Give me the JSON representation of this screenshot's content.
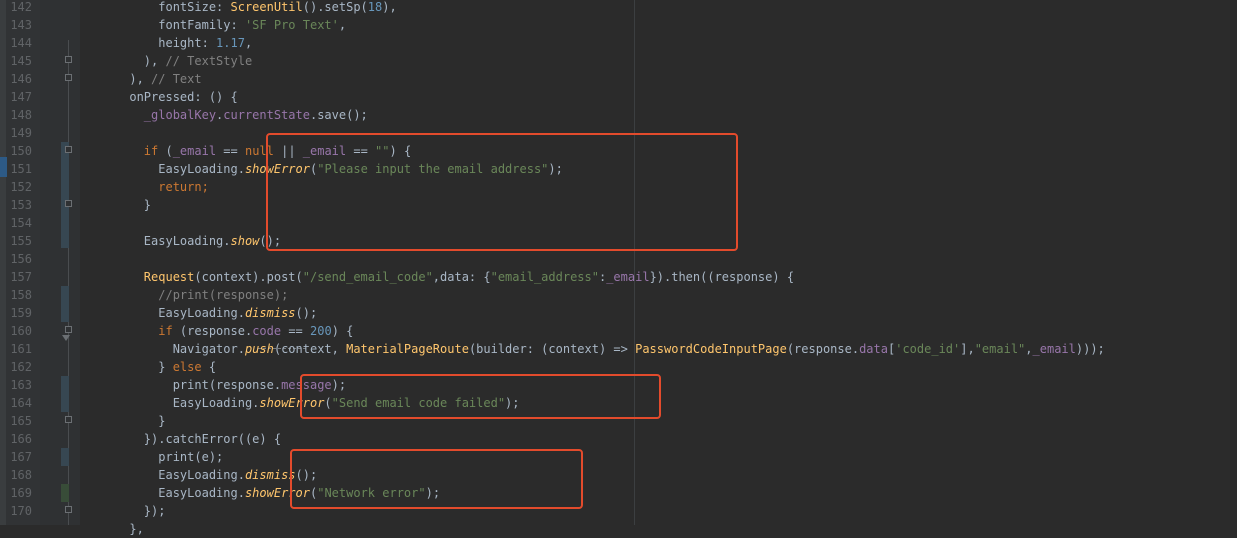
{
  "editor": {
    "lines": [
      {
        "n": "142",
        "tokens": [
          {
            "t": "          fontSize: "
          },
          {
            "t": "ScreenUtil",
            "c": "cls"
          },
          {
            "t": "().setSp("
          },
          {
            "t": "18",
            "c": "num"
          },
          {
            "t": "),"
          }
        ]
      },
      {
        "n": "143",
        "tokens": [
          {
            "t": "          fontFamily: "
          },
          {
            "t": "'SF Pro Text'",
            "c": "str"
          },
          {
            "t": ","
          }
        ]
      },
      {
        "n": "144",
        "tokens": [
          {
            "t": "          height: "
          },
          {
            "t": "1.17",
            "c": "num"
          },
          {
            "t": ","
          }
        ]
      },
      {
        "n": "145",
        "tokens": [
          {
            "t": "        ), "
          },
          {
            "t": "// TextStyle",
            "c": "com"
          }
        ]
      },
      {
        "n": "146",
        "tokens": [
          {
            "t": "      ), "
          },
          {
            "t": "// Text",
            "c": "com"
          }
        ]
      },
      {
        "n": "147",
        "tokens": [
          {
            "t": "      onPressed: () {"
          }
        ]
      },
      {
        "n": "148",
        "tokens": [
          {
            "t": "        "
          },
          {
            "t": "_globalKey",
            "c": "fld"
          },
          {
            "t": "."
          },
          {
            "t": "currentState",
            "c": "fld"
          },
          {
            "t": ".save();"
          }
        ]
      },
      {
        "n": "149",
        "tokens": [
          {
            "t": ""
          }
        ]
      },
      {
        "n": "150",
        "tokens": [
          {
            "t": "        "
          },
          {
            "t": "if",
            "c": "kw"
          },
          {
            "t": " ("
          },
          {
            "t": "_email",
            "c": "fld"
          },
          {
            "t": " == "
          },
          {
            "t": "null",
            "c": "kw"
          },
          {
            "t": " || "
          },
          {
            "t": "_email",
            "c": "fld"
          },
          {
            "t": " == "
          },
          {
            "t": "\"\"",
            "c": "str"
          },
          {
            "t": ") {"
          }
        ]
      },
      {
        "n": "151",
        "tokens": [
          {
            "t": "          EasyLoading."
          },
          {
            "t": "showError",
            "c": "ital"
          },
          {
            "t": "("
          },
          {
            "t": "\"Please input the email address\"",
            "c": "str"
          },
          {
            "t": ");"
          }
        ]
      },
      {
        "n": "152",
        "tokens": [
          {
            "t": "          "
          },
          {
            "t": "return;",
            "c": "kw"
          }
        ]
      },
      {
        "n": "153",
        "tokens": [
          {
            "t": "        }"
          }
        ]
      },
      {
        "n": "154",
        "tokens": [
          {
            "t": ""
          }
        ]
      },
      {
        "n": "155",
        "tokens": [
          {
            "t": "        EasyLoading."
          },
          {
            "t": "show",
            "c": "ital"
          },
          {
            "t": "();"
          }
        ]
      },
      {
        "n": "156",
        "tokens": [
          {
            "t": ""
          }
        ]
      },
      {
        "n": "157",
        "tokens": [
          {
            "t": "        "
          },
          {
            "t": "Request",
            "c": "cls"
          },
          {
            "t": "(context).post("
          },
          {
            "t": "\"/send_email_code\"",
            "c": "str"
          },
          {
            "t": ",data: {"
          },
          {
            "t": "\"email_address\"",
            "c": "str"
          },
          {
            "t": ":"
          },
          {
            "t": "_email",
            "c": "fld"
          },
          {
            "t": "}).then((response) {"
          }
        ]
      },
      {
        "n": "158",
        "tokens": [
          {
            "t": "          "
          },
          {
            "t": "//print(response);",
            "c": "com"
          }
        ]
      },
      {
        "n": "159",
        "tokens": [
          {
            "t": "          EasyLoading."
          },
          {
            "t": "dismiss",
            "c": "ital"
          },
          {
            "t": "();"
          }
        ]
      },
      {
        "n": "160",
        "tokens": [
          {
            "t": "          "
          },
          {
            "t": "if",
            "c": "kw"
          },
          {
            "t": " (response."
          },
          {
            "t": "code",
            "c": "fld"
          },
          {
            "t": " == "
          },
          {
            "t": "200",
            "c": "num"
          },
          {
            "t": ") {"
          }
        ]
      },
      {
        "n": "161",
        "tokens": [
          {
            "t": "            Navigator."
          },
          {
            "t": "push",
            "c": "ital"
          },
          {
            "t": "(context, "
          },
          {
            "t": "MaterialPageRoute",
            "c": "cls"
          },
          {
            "t": "(builder: (context) => "
          },
          {
            "t": "PasswordCodeInputPage",
            "c": "cls"
          },
          {
            "t": "(response."
          },
          {
            "t": "data",
            "c": "fld"
          },
          {
            "t": "["
          },
          {
            "t": "'code_id'",
            "c": "str"
          },
          {
            "t": "],"
          },
          {
            "t": "\"email\"",
            "c": "str"
          },
          {
            "t": ","
          },
          {
            "t": "_email",
            "c": "fld"
          },
          {
            "t": ")));"
          }
        ]
      },
      {
        "n": "162",
        "tokens": [
          {
            "t": "          } "
          },
          {
            "t": "else",
            "c": "kw"
          },
          {
            "t": " {"
          }
        ]
      },
      {
        "n": "163",
        "tokens": [
          {
            "t": "            print(response."
          },
          {
            "t": "message",
            "c": "fld"
          },
          {
            "t": ");"
          }
        ]
      },
      {
        "n": "164",
        "tokens": [
          {
            "t": "            EasyLoading."
          },
          {
            "t": "showError",
            "c": "ital"
          },
          {
            "t": "("
          },
          {
            "t": "\"Send email code failed\"",
            "c": "str"
          },
          {
            "t": ");"
          }
        ]
      },
      {
        "n": "165",
        "tokens": [
          {
            "t": "          }"
          }
        ]
      },
      {
        "n": "166",
        "tokens": [
          {
            "t": "        }).catchError((e) {"
          }
        ]
      },
      {
        "n": "167",
        "tokens": [
          {
            "t": "          print(e);"
          }
        ]
      },
      {
        "n": "168",
        "tokens": [
          {
            "t": "          EasyLoading."
          },
          {
            "t": "dismiss",
            "c": "ital"
          },
          {
            "t": "();"
          }
        ]
      },
      {
        "n": "169",
        "tokens": [
          {
            "t": "          EasyLoading."
          },
          {
            "t": "showError",
            "c": "ital"
          },
          {
            "t": "("
          },
          {
            "t": "\"Network error\"",
            "c": "str"
          },
          {
            "t": ");"
          }
        ]
      },
      {
        "n": "170",
        "tokens": [
          {
            "t": "        });"
          }
        ]
      },
      {
        "n": "",
        "tokens": [
          {
            "t": "      },"
          }
        ]
      }
    ]
  },
  "colors": {
    "background": "#2b2b2b",
    "keyword": "#cc7832",
    "string": "#6a8759",
    "number": "#6897bb",
    "field": "#9876aa",
    "class_method": "#ffc66d",
    "comment": "#808080",
    "highlight_box": "#e34b2c"
  }
}
